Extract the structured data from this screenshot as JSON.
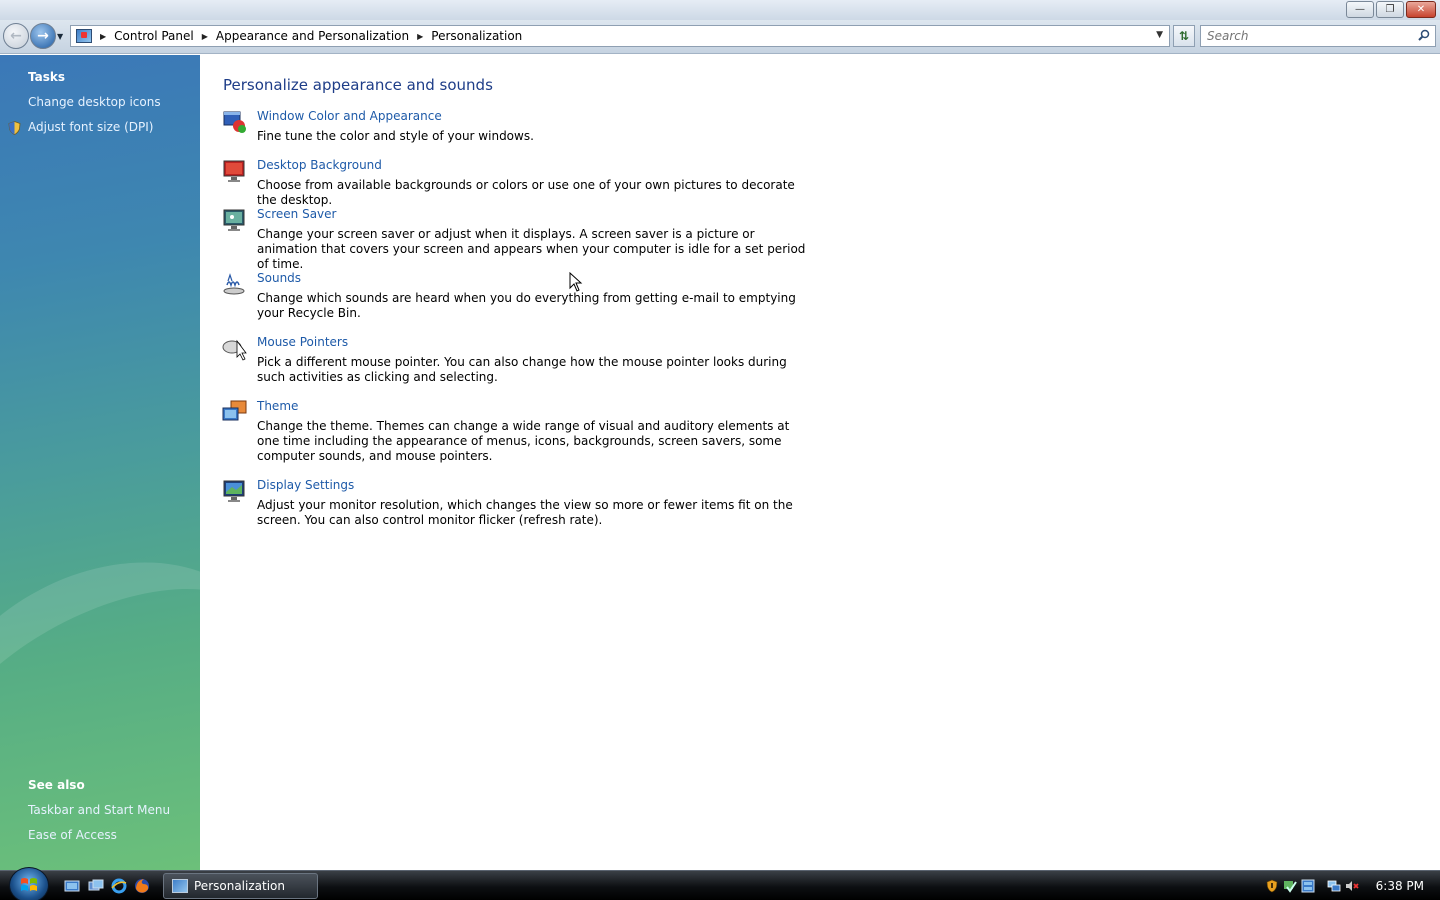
{
  "window": {
    "minimize_glyph": "—",
    "maximize_glyph": "❐",
    "close_glyph": "✕"
  },
  "address_bar": {
    "breadcrumbs": [
      "Control Panel",
      "Appearance and Personalization",
      "Personalization"
    ],
    "search_placeholder": "Search"
  },
  "left_pane": {
    "tasks_heading": "Tasks",
    "tasks": [
      "Change desktop icons",
      "Adjust font size (DPI)"
    ],
    "see_also_heading": "See also",
    "see_also": [
      "Taskbar and Start Menu",
      "Ease of Access"
    ]
  },
  "main": {
    "title": "Personalize appearance and sounds",
    "items": [
      {
        "icon": "window-color-icon",
        "label": "Window Color and Appearance",
        "description": "Fine tune the color and style of your windows."
      },
      {
        "icon": "desktop-background-icon",
        "label": "Desktop Background",
        "description": "Choose from available backgrounds or colors or use one of your own pictures to decorate the desktop."
      },
      {
        "icon": "screen-saver-icon",
        "label": "Screen Saver",
        "description": "Change your screen saver or adjust when it displays. A screen saver is a picture or animation that covers your screen and appears when your computer is idle for a set period of time."
      },
      {
        "icon": "sounds-icon",
        "label": "Sounds",
        "description": "Change which sounds are heard when you do everything from getting e-mail to emptying your Recycle Bin."
      },
      {
        "icon": "mouse-pointers-icon",
        "label": "Mouse Pointers",
        "description": "Pick a different mouse pointer. You can also change how the mouse pointer looks during such activities as clicking and selecting."
      },
      {
        "icon": "theme-icon",
        "label": "Theme",
        "description": "Change the theme. Themes can change a wide range of visual and auditory elements at one time including the appearance of menus, icons, backgrounds, screen savers, some computer sounds, and mouse pointers."
      },
      {
        "icon": "display-settings-icon",
        "label": "Display Settings",
        "description": "Adjust your monitor resolution, which changes the view so more or fewer items fit on the screen. You can also control monitor flicker (refresh rate)."
      }
    ]
  },
  "taskbar": {
    "active_window": "Personalization",
    "clock": "6:38 PM"
  }
}
